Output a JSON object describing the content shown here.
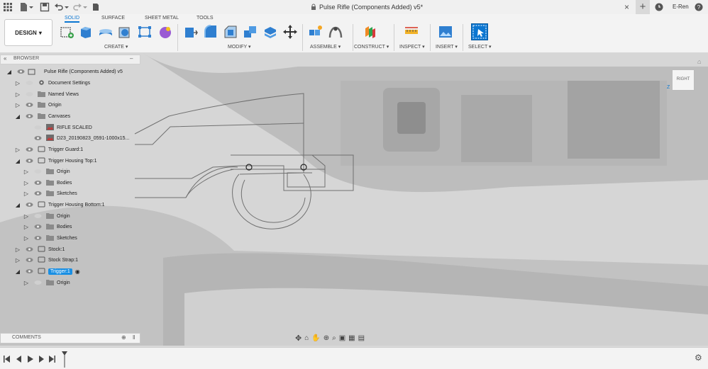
{
  "titlebar": {
    "document_title": "Pulse Rifle (Components Added) v5*",
    "user": "E-Ren"
  },
  "toolbar": {
    "design_label": "DESIGN",
    "tabs": [
      "SOLID",
      "SURFACE",
      "SHEET METAL",
      "TOOLS"
    ],
    "groups": [
      "CREATE",
      "MODIFY",
      "ASSEMBLE",
      "CONSTRUCT",
      "INSPECT",
      "INSERT",
      "SELECT"
    ]
  },
  "browser": {
    "title": "BROWSER",
    "root": "Pulse Rifle (Components Added) v5",
    "items": [
      {
        "label": "Document Settings"
      },
      {
        "label": "Named Views"
      },
      {
        "label": "Origin"
      },
      {
        "label": "Canvases"
      },
      {
        "label": "RIFLE SCALED"
      },
      {
        "label": "D23_20190823_0591-1000x15..."
      },
      {
        "label": "Trigger Guard:1"
      },
      {
        "label": "Trigger Housing Top:1"
      },
      {
        "label": "Origin"
      },
      {
        "label": "Bodies"
      },
      {
        "label": "Sketches"
      },
      {
        "label": "Trigger Housing Bottom:1"
      },
      {
        "label": "Origin"
      },
      {
        "label": "Bodies"
      },
      {
        "label": "Sketches"
      },
      {
        "label": "Stock:1"
      },
      {
        "label": "Stock Strap:1"
      },
      {
        "label": "Trigger:1"
      },
      {
        "label": "Origin"
      }
    ]
  },
  "viewcube": {
    "face": "RIGHT",
    "axis_z": "Z"
  },
  "comments": {
    "title": "COMMENTS"
  },
  "colors": {
    "accent": "#0b76d1",
    "selected_row": "#1a8fe3"
  }
}
